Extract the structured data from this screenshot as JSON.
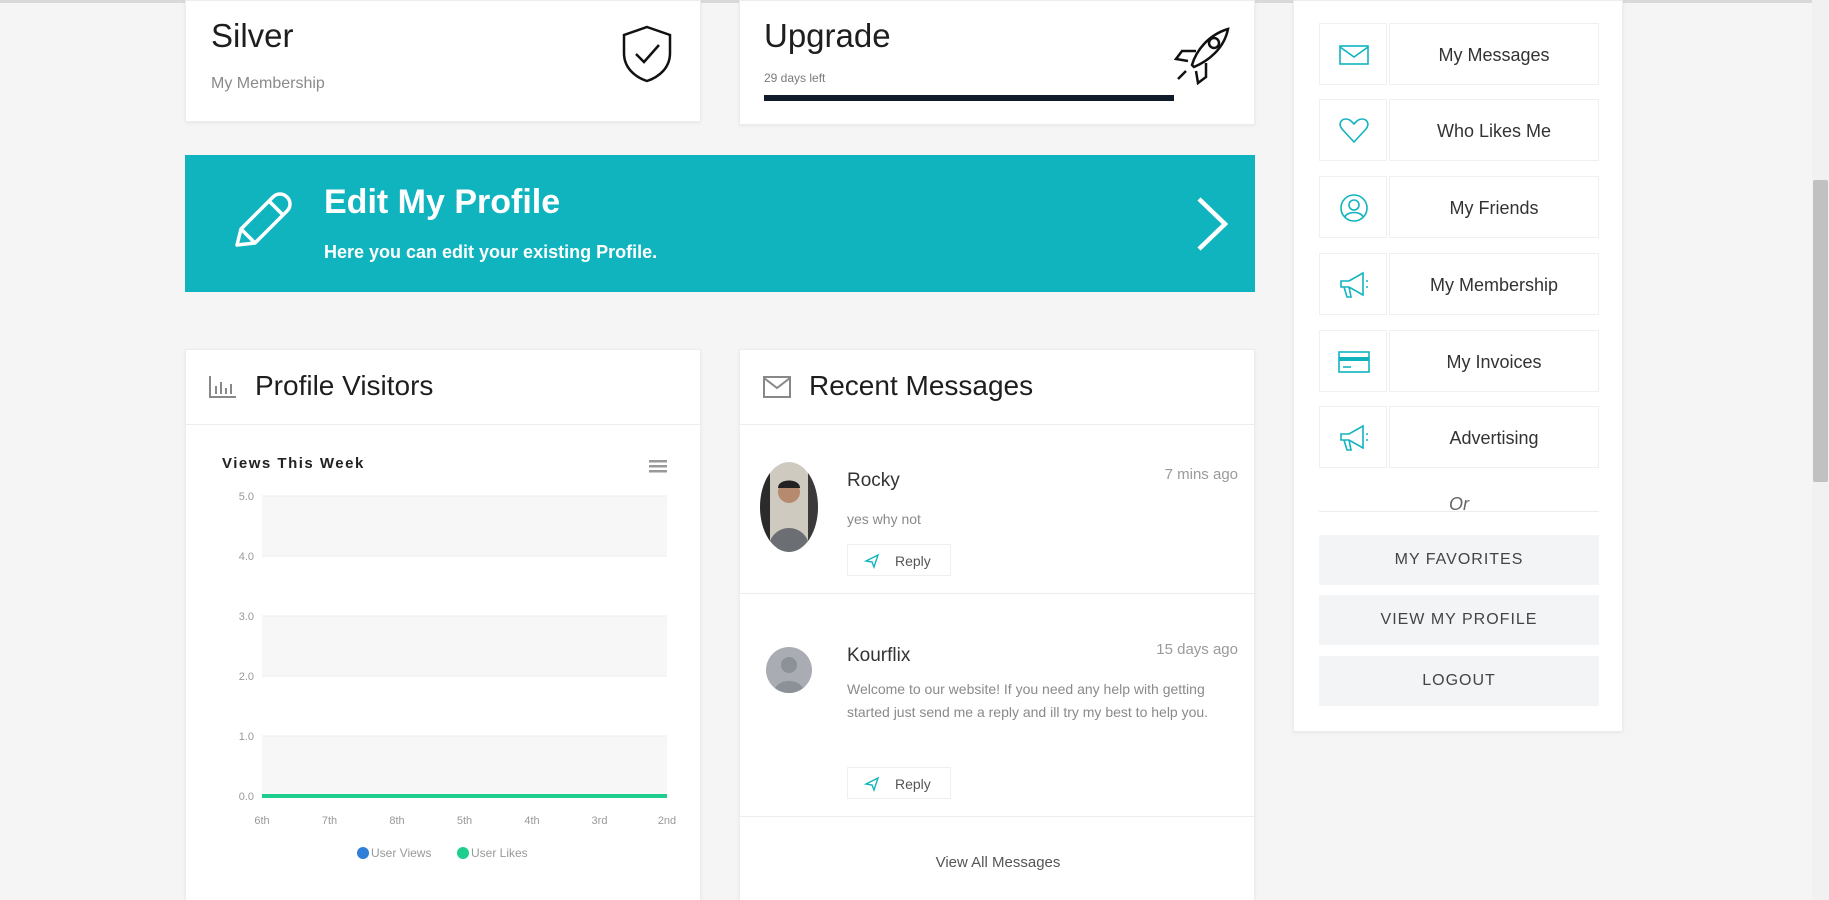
{
  "membership_card": {
    "title": "Silver",
    "subtitle": "My Membership"
  },
  "upgrade_card": {
    "title": "Upgrade",
    "subtitle": "29 days left",
    "progress": 1.0
  },
  "edit_profile": {
    "title": "Edit My Profile",
    "subtitle": "Here you can edit your existing Profile."
  },
  "visitors": {
    "title": "Profile Visitors"
  },
  "messages": {
    "title": "Recent Messages",
    "items": [
      {
        "name": "Rocky",
        "time": "7 mins ago",
        "text": "yes why not",
        "reply_label": "Reply"
      },
      {
        "name": "Kourflix",
        "time": "15 days ago",
        "text": "Welcome to our website! If you need any help with getting started just send me a reply and ill try my best to help you.",
        "reply_label": "Reply"
      }
    ],
    "view_all": "View All Messages"
  },
  "sidebar": {
    "items": [
      {
        "label": "My Messages",
        "icon": "envelope-icon"
      },
      {
        "label": "Who Likes Me",
        "icon": "heart-icon"
      },
      {
        "label": "My Friends",
        "icon": "user-circle-icon"
      },
      {
        "label": "My Membership",
        "icon": "megaphone-icon"
      },
      {
        "label": "My Invoices",
        "icon": "credit-card-icon"
      },
      {
        "label": "Advertising",
        "icon": "megaphone-icon"
      }
    ],
    "or_text": "Or",
    "buttons": [
      "MY FAVORITES",
      "VIEW MY PROFILE",
      "LOGOUT"
    ]
  },
  "colors": {
    "accent": "#10b4bf",
    "user_views": "#2f7ed8",
    "user_likes": "#1fce8f"
  },
  "chart_data": {
    "type": "line",
    "title": "Views This Week",
    "categories": [
      "6th",
      "7th",
      "8th",
      "5th",
      "4th",
      "3rd",
      "2nd"
    ],
    "series": [
      {
        "name": "User Views",
        "values": [
          0,
          0,
          0,
          0,
          0,
          0,
          0
        ]
      },
      {
        "name": "User Likes",
        "values": [
          0,
          0,
          0,
          0,
          0,
          0,
          0
        ]
      }
    ],
    "y_ticks": [
      "5.0",
      "4.0",
      "3.0",
      "2.0",
      "1.0",
      "0.0"
    ],
    "ylim": [
      0,
      5
    ],
    "grid": "alternating-bands",
    "legend": "bottom-center"
  }
}
